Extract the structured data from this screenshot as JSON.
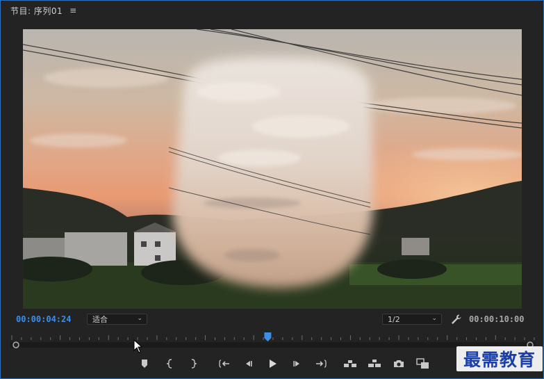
{
  "panel": {
    "title": "节目: 序列01",
    "menu_icon": "hamburger-menu-icon"
  },
  "viewer": {
    "content": "video-frame-sunset-with-vignette-mask"
  },
  "controls": {
    "current_timecode": "00:00:04:24",
    "fit_select": {
      "value": "适合"
    },
    "resolution_select": {
      "value": "1/2"
    },
    "settings_icon": "wrench-icon",
    "duration_timecode": "00:00:10:00"
  },
  "playhead": {
    "position_fraction": 0.49
  },
  "transport": {
    "buttons": [
      {
        "name": "add-marker-button",
        "icon": "marker-icon"
      },
      {
        "name": "mark-in-button",
        "icon": "mark-in-icon"
      },
      {
        "name": "mark-out-button",
        "icon": "mark-out-icon"
      },
      {
        "name": "go-to-in-button",
        "icon": "go-to-in-icon"
      },
      {
        "name": "step-back-button",
        "icon": "step-back-icon"
      },
      {
        "name": "play-button",
        "icon": "play-icon"
      },
      {
        "name": "step-forward-button",
        "icon": "step-forward-icon"
      },
      {
        "name": "go-to-out-button",
        "icon": "go-to-out-icon"
      },
      {
        "name": "lift-button",
        "icon": "lift-icon"
      },
      {
        "name": "extract-button",
        "icon": "extract-icon"
      },
      {
        "name": "export-frame-button",
        "icon": "camera-icon"
      },
      {
        "name": "comparison-view-button",
        "icon": "comparison-view-icon"
      }
    ]
  },
  "watermark": {
    "text": "最需教育"
  },
  "colors": {
    "accent": "#3d8ee8",
    "panel_bg": "#232323",
    "border": "#2d6fb8"
  }
}
